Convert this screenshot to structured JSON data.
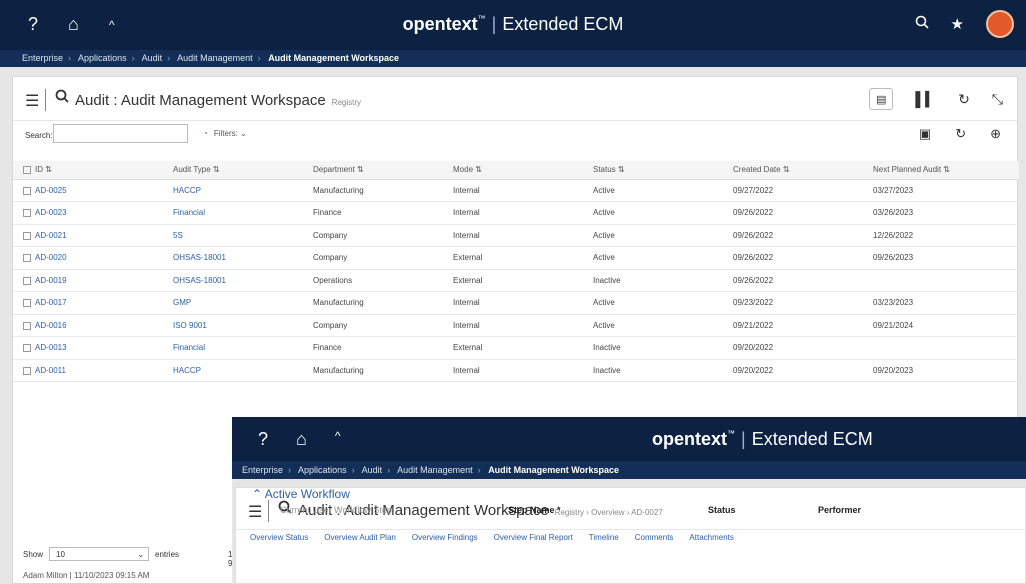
{
  "app": {
    "brand": "opentext",
    "tm": "™",
    "product": "Extended ECM",
    "icons": [
      "help-icon",
      "home-icon",
      "caret-up-icon",
      "search-icon",
      "star-icon",
      "avatar"
    ]
  },
  "breadcrumb": [
    "Enterprise",
    "Applications",
    "Audit",
    "Audit Management",
    "Audit Management Workspace"
  ],
  "header": {
    "title": "Audit : Audit Management Workspace",
    "sub": "Registry"
  },
  "search": {
    "label": "Search:",
    "filters_label": "Filters:"
  },
  "table": {
    "columns": [
      "ID",
      "Audit Type",
      "Department",
      "Mode",
      "Status",
      "Created Date",
      "Next Planned Audit"
    ],
    "rows": [
      [
        "AD-0025",
        "HACCP",
        "Manufacturing",
        "Internal",
        "Active",
        "09/27/2022",
        "03/27/2023"
      ],
      [
        "AD-0023",
        "Financial",
        "Finance",
        "Internal",
        "Active",
        "09/26/2022",
        "03/26/2023"
      ],
      [
        "AD-0021",
        "5S",
        "Company",
        "Internal",
        "Active",
        "09/26/2022",
        "12/26/2022"
      ],
      [
        "AD-0020",
        "OHSAS-18001",
        "Company",
        "External",
        "Active",
        "09/26/2022",
        "09/26/2023"
      ],
      [
        "AD-0019",
        "OHSAS-18001",
        "Operations",
        "External",
        "Inactive",
        "09/26/2022",
        ""
      ],
      [
        "AD-0017",
        "GMP",
        "Manufacturing",
        "Internal",
        "Active",
        "09/23/2022",
        "03/23/2023"
      ],
      [
        "AD-0016",
        "ISO 9001",
        "Company",
        "Internal",
        "Active",
        "09/21/2022",
        "09/21/2024"
      ],
      [
        "AD-0013",
        "Financial",
        "Finance",
        "External",
        "Inactive",
        "09/20/2022",
        ""
      ],
      [
        "AD-0011",
        "HACCP",
        "Manufacturing",
        "Internal",
        "Inactive",
        "09/20/2022",
        "09/20/2023"
      ]
    ]
  },
  "footer": {
    "show": "Show",
    "page_size": "10",
    "entries": "entries",
    "page_info": "1 - 9",
    "status": "Adam Milton | 11/10/2023 09:15 AM"
  },
  "overlay": {
    "breadcrumb": [
      "Enterprise",
      "Applications",
      "Audit",
      "Audit Management",
      "Audit Management Workspace"
    ],
    "title": "Audit : Audit Management Workspace",
    "sub": "Registry › Overview › AD-0027",
    "tabs": [
      "Overview  Status",
      "Overview  Audit Plan",
      "Overview  Findings",
      "Overview  Final Report",
      "Timeline",
      "Comments",
      "Attachments"
    ],
    "section": "Active Workflow",
    "wf_headers": [
      "Current User Workflow Step",
      "Step Name *",
      "Status",
      "Performer"
    ]
  },
  "colors": {
    "navy": "#0d2243",
    "link": "#2e5fa3"
  }
}
